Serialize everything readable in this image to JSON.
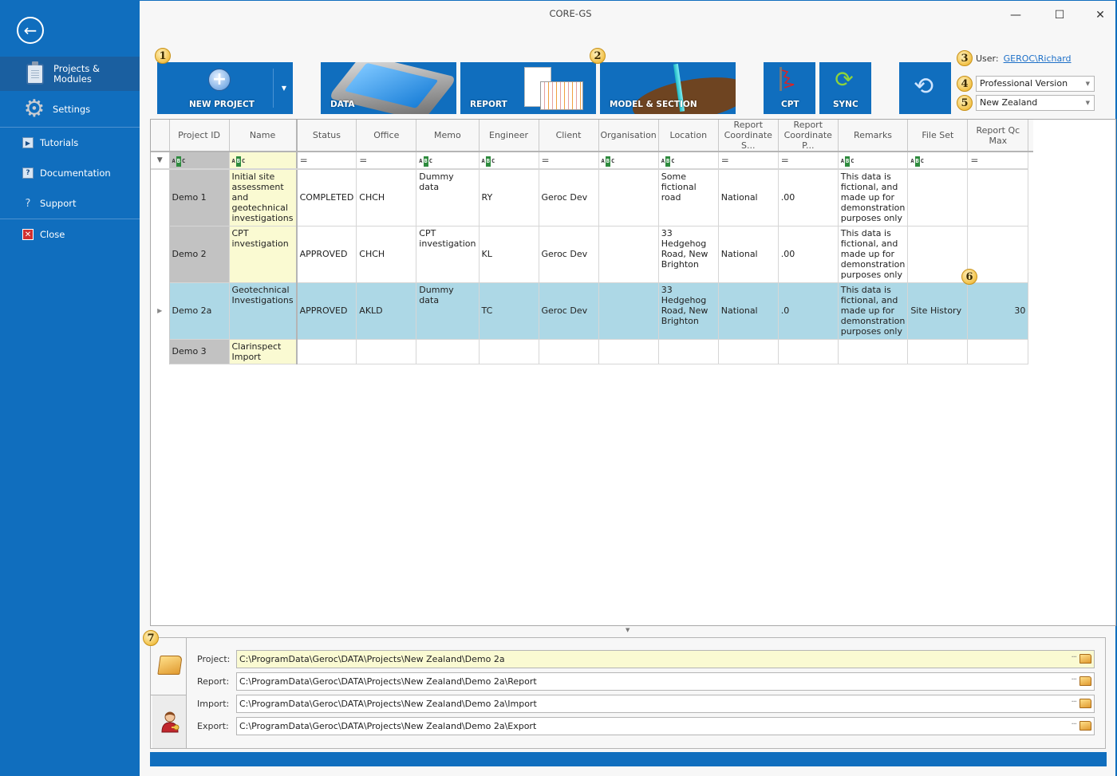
{
  "window": {
    "title": "CORE-GS",
    "controls": {
      "minimize": "—",
      "maximize": "☐",
      "close": "✕"
    }
  },
  "sidebar": {
    "back_icon": "←",
    "items": [
      {
        "label": "Projects & Modules",
        "label_line1": "Projects &",
        "label_line2": "Modules",
        "icon": "clipboard-icon",
        "active": true
      },
      {
        "label": "Settings",
        "icon": "gear-icon"
      },
      {
        "label": "Tutorials",
        "icon": "tutorials-icon"
      },
      {
        "label": "Documentation",
        "icon": "documentation-icon"
      },
      {
        "label": "Support",
        "icon": "help-icon"
      },
      {
        "label": "Close",
        "icon": "close-icon"
      }
    ]
  },
  "toolbar": {
    "badges": [
      "1",
      "2",
      "3",
      "4",
      "5",
      "6",
      "7"
    ],
    "new_project": "NEW PROJECT",
    "data": "DATA",
    "report": "REPORT",
    "model_section": "MODEL & SECTION",
    "cpt": "CPT",
    "sync": "SYNC"
  },
  "user": {
    "label": "User:",
    "name": "GEROC\\Richard"
  },
  "version_select": {
    "value": "Professional Version"
  },
  "region_select": {
    "value": "New Zealand"
  },
  "grid": {
    "columns": [
      "Project ID",
      "Name",
      "Status",
      "Office",
      "Memo",
      "Engineer",
      "Client",
      "Organisation",
      "Location",
      "Report Coordinate S...",
      "Report Coordinate P...",
      "Remarks",
      "File Set",
      "Report Qc Max"
    ],
    "column_headers_display": {
      "report_coord_s_1": "Report",
      "report_coord_s_2": "Coordinate S...",
      "report_coord_p_1": "Report",
      "report_coord_p_2": "Coordinate P...",
      "qc_1": "Report Qc",
      "qc_2": "Max"
    },
    "filter_types": [
      "text",
      "text",
      "equals",
      "equals",
      "text",
      "text",
      "equals",
      "text",
      "text",
      "equals",
      "equals",
      "text",
      "text",
      "equals"
    ],
    "filter_text_glyph": "ABC",
    "filter_equals_glyph": "=",
    "rows": [
      {
        "project_id": "Demo 1",
        "name": "Initial site assessment and geotechnical investigations",
        "status": "COMPLETED",
        "office": "CHCH",
        "memo": "Dummy data",
        "engineer": "RY",
        "client": "Geroc Dev",
        "organisation": "",
        "location": "Some fictional road",
        "coord_s": "National",
        "coord_p": ".00",
        "remarks": "This data is fictional, and made up for demonstration purposes only",
        "file_set": "",
        "qc_max": "",
        "selected": false
      },
      {
        "project_id": "Demo 2",
        "name": "CPT investigation",
        "status": "APPROVED",
        "office": "CHCH",
        "memo": "CPT investigation",
        "engineer": "KL",
        "client": "Geroc Dev",
        "organisation": "",
        "location": "33 Hedgehog Road, New Brighton",
        "coord_s": "National",
        "coord_p": ".00",
        "remarks": "This data is fictional, and made up for demonstration purposes only",
        "file_set": "",
        "qc_max": "",
        "selected": false
      },
      {
        "project_id": "Demo 2a",
        "name": "Geotechnical Investigations",
        "status": "APPROVED",
        "office": "AKLD",
        "memo": "Dummy data",
        "engineer": "TC",
        "client": "Geroc Dev",
        "organisation": "",
        "location": "33 Hedgehog Road, New Brighton",
        "coord_s": "National",
        "coord_p": ".0",
        "remarks": "This data is fictional, and made up for demonstration purposes only",
        "file_set": "Site History",
        "qc_max": "30",
        "selected": true
      },
      {
        "project_id": "Demo 3",
        "name": "Clarinspect Import",
        "status": "",
        "office": "",
        "memo": "",
        "engineer": "",
        "client": "",
        "organisation": "",
        "location": "",
        "coord_s": "",
        "coord_p": "",
        "remarks": "",
        "file_set": "",
        "qc_max": "",
        "selected": false
      }
    ]
  },
  "paths": {
    "project": {
      "label": "Project:",
      "value": "C:\\ProgramData\\Geroc\\DATA\\Projects\\New Zealand\\Demo 2a"
    },
    "report": {
      "label": "Report:",
      "value": "C:\\ProgramData\\Geroc\\DATA\\Projects\\New Zealand\\Demo 2a\\Report"
    },
    "import": {
      "label": "Import:",
      "value": "C:\\ProgramData\\Geroc\\DATA\\Projects\\New Zealand\\Demo 2a\\Import"
    },
    "export": {
      "label": "Export:",
      "value": "C:\\ProgramData\\Geroc\\DATA\\Projects\\New Zealand\\Demo 2a\\Export"
    },
    "ellipsis": "···"
  },
  "colors": {
    "brand_blue": "#106ebe",
    "selected_row": "#add8e6",
    "name_column": "#fafad2",
    "id_column": "#c2c2c2",
    "badge": "#f2c24a"
  }
}
